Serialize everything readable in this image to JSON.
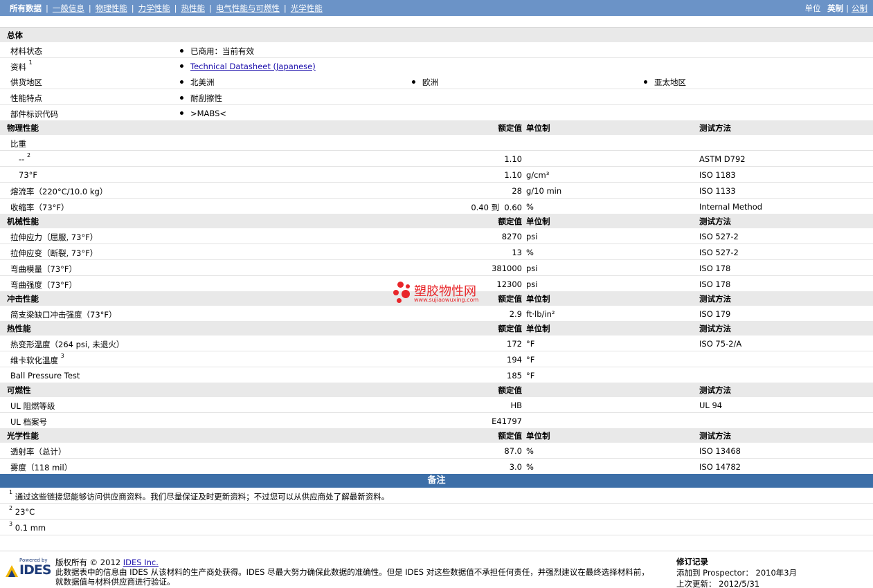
{
  "nav": {
    "tabs": [
      "所有数据",
      "一般信息",
      "物理性能",
      "力学性能",
      "热性能",
      "电气性能与可燃性",
      "光学性能"
    ],
    "unit_label": "单位",
    "unit_english": "英制",
    "unit_metric": "公制"
  },
  "general": {
    "title": "总体",
    "material_status_label": "材料状态",
    "material_status": "已商用：当前有效",
    "resources_label": "资料",
    "resources_sup": "1",
    "resources_link": "Technical Datasheet (Japanese)",
    "availability_label": "供货地区",
    "availability": [
      "北美洲",
      "欧洲",
      "亚太地区"
    ],
    "features_label": "性能特点",
    "features": "耐刮擦性",
    "part_marking_label": "部件标识代码",
    "part_marking": ">MABS<"
  },
  "column_headers": {
    "nominal": "额定值",
    "unit": "单位制",
    "method": "测试方法"
  },
  "physical": {
    "title": "物理性能",
    "rows": [
      {
        "label": "比重",
        "sup": "",
        "value": "",
        "unit": "",
        "method": ""
      },
      {
        "label": "--",
        "sup": "2",
        "value": "1.10",
        "unit": "",
        "method": "ASTM D792"
      },
      {
        "label": "73°F",
        "sup": "",
        "value": "1.10",
        "unit": "g/cm³",
        "method": "ISO 1183"
      },
      {
        "label": "熔流率（220°C/10.0 kg）",
        "sup": "",
        "value": "28",
        "unit": "g/10 min",
        "method": "ISO 1133"
      },
      {
        "label": "收缩率（73°F）",
        "sup": "",
        "value": "0.40 到  0.60",
        "unit": "%",
        "method": "Internal Method"
      }
    ]
  },
  "mechanical": {
    "title": "机械性能",
    "rows": [
      {
        "label": "拉伸应力（屈服, 73°F）",
        "value": "8270",
        "unit": "psi",
        "method": "ISO 527-2"
      },
      {
        "label": "拉伸应变（断裂, 73°F）",
        "value": "13",
        "unit": "%",
        "method": "ISO 527-2"
      },
      {
        "label": "弯曲模量（73°F）",
        "value": "381000",
        "unit": "psi",
        "method": "ISO 178"
      },
      {
        "label": "弯曲强度（73°F）",
        "value": "12300",
        "unit": "psi",
        "method": "ISO 178"
      }
    ]
  },
  "impact": {
    "title": "冲击性能",
    "rows": [
      {
        "label": "简支梁缺口冲击强度（73°F）",
        "value": "2.9",
        "unit": "ft·lb/in²",
        "method": "ISO 179"
      }
    ]
  },
  "thermal": {
    "title": "热性能",
    "rows": [
      {
        "label": "热变形温度（264 psi, 未退火）",
        "sup": "",
        "value": "172",
        "unit": "°F",
        "method": "ISO 75-2/A"
      },
      {
        "label": "维卡软化温度",
        "sup": "3",
        "value": "194",
        "unit": "°F",
        "method": ""
      },
      {
        "label": "Ball Pressure Test",
        "sup": "",
        "value": "185",
        "unit": "°F",
        "method": ""
      }
    ]
  },
  "flammability": {
    "title": "可燃性",
    "rows": [
      {
        "label": "UL 阻燃等级",
        "value": "HB",
        "unit": "",
        "method": "UL 94"
      },
      {
        "label": "UL 档案号",
        "value": "E41797",
        "unit": "",
        "method": ""
      }
    ]
  },
  "optical": {
    "title": "光学性能",
    "rows": [
      {
        "label": "透射率（总计）",
        "value": "87.0",
        "unit": "%",
        "method": "ISO 13468"
      },
      {
        "label": "雾度（118 mil）",
        "value": "3.0",
        "unit": "%",
        "method": "ISO 14782"
      }
    ]
  },
  "notes": {
    "title": "备注",
    "items": [
      {
        "num": "1",
        "text": "通过这些链接您能够访问供应商资料。我们尽量保证及时更新资料；不过您可以从供应商处了解最新资料。"
      },
      {
        "num": "2",
        "text": "23°C"
      },
      {
        "num": "3",
        "text": "0.1 mm"
      }
    ]
  },
  "footer": {
    "powered_by": "Powered by",
    "logo_text": "IDES",
    "copyright_prefix": "版权所有 © 2012 ",
    "copyright_link": "IDES Inc.",
    "disclaimer_1": "此数据表中的信息由 IDES 从该材料的生产商处获得。IDES 尽最大努力确保此数据的准确性。但是 IDES 对这些数据值不承担任何责任，并强烈建议在最终选择材料前，",
    "disclaimer_2": "就数据值与材料供应商进行验证。",
    "revision_title": "修订记录",
    "added_label": "添加到 Prospector：",
    "added_value": "2010年3月",
    "updated_label": "上次更新：",
    "updated_value": "2012/5/31"
  },
  "watermark": {
    "title": "塑胶物性网",
    "url": "www.sujiaowuxing.com"
  }
}
